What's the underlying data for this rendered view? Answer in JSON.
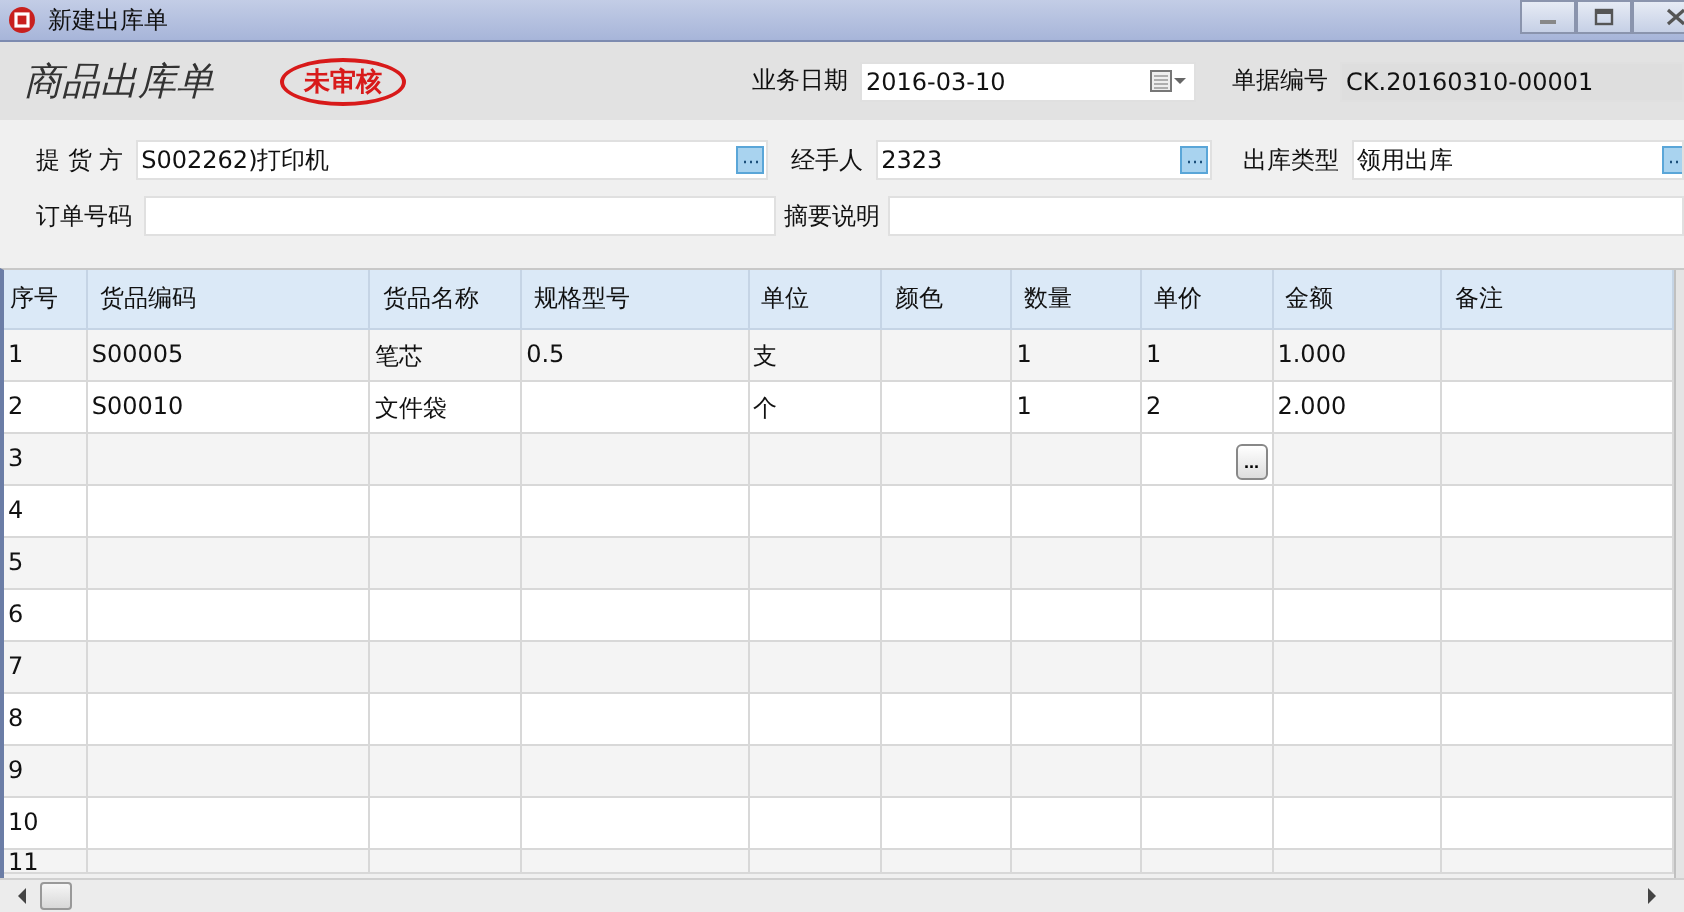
{
  "window": {
    "title": "新建出库单"
  },
  "header": {
    "title": "商品出库单",
    "stamp": "未审核",
    "date_label": "业务日期",
    "date": "2016-03-10",
    "doc_no_label": "单据编号",
    "doc_no": "CK.20160310-00001"
  },
  "form": {
    "fields": [
      {
        "label": "提 货 方",
        "value": "S002262)打印机",
        "kind": "lookup"
      },
      {
        "label": "经手人",
        "value": "2323",
        "kind": "lookup"
      },
      {
        "label": "出库类型",
        "value": "领用出库",
        "kind": "lookup"
      },
      {
        "label": "订单号码",
        "kind": "text"
      },
      {
        "label": "摘要说明",
        "kind": "text"
      }
    ]
  },
  "table": {
    "columns": [
      "序号",
      "货品编码",
      "货品名称",
      "规格型号",
      "单位",
      "颜色",
      "数量",
      "单价",
      "金额",
      "备注"
    ],
    "rows": [
      {
        "cells": [
          "1",
          "S00005",
          "笔芯",
          "0.5",
          "支",
          "",
          "1",
          "1",
          "1.000",
          ""
        ]
      },
      {
        "cells": [
          "2",
          "S00010",
          "文件袋",
          "",
          "个",
          "",
          "1",
          "2",
          "2.000",
          ""
        ]
      },
      {
        "cells": [
          "3"
        ],
        "editor_button": "..."
      },
      {
        "cells": [
          "4"
        ]
      },
      {
        "cells": [
          "5"
        ]
      },
      {
        "cells": [
          "6"
        ]
      },
      {
        "cells": [
          "7"
        ]
      },
      {
        "cells": [
          "8"
        ]
      },
      {
        "cells": [
          "9"
        ]
      },
      {
        "cells": [
          "10"
        ]
      },
      {
        "cells": [
          "11"
        ]
      }
    ]
  }
}
